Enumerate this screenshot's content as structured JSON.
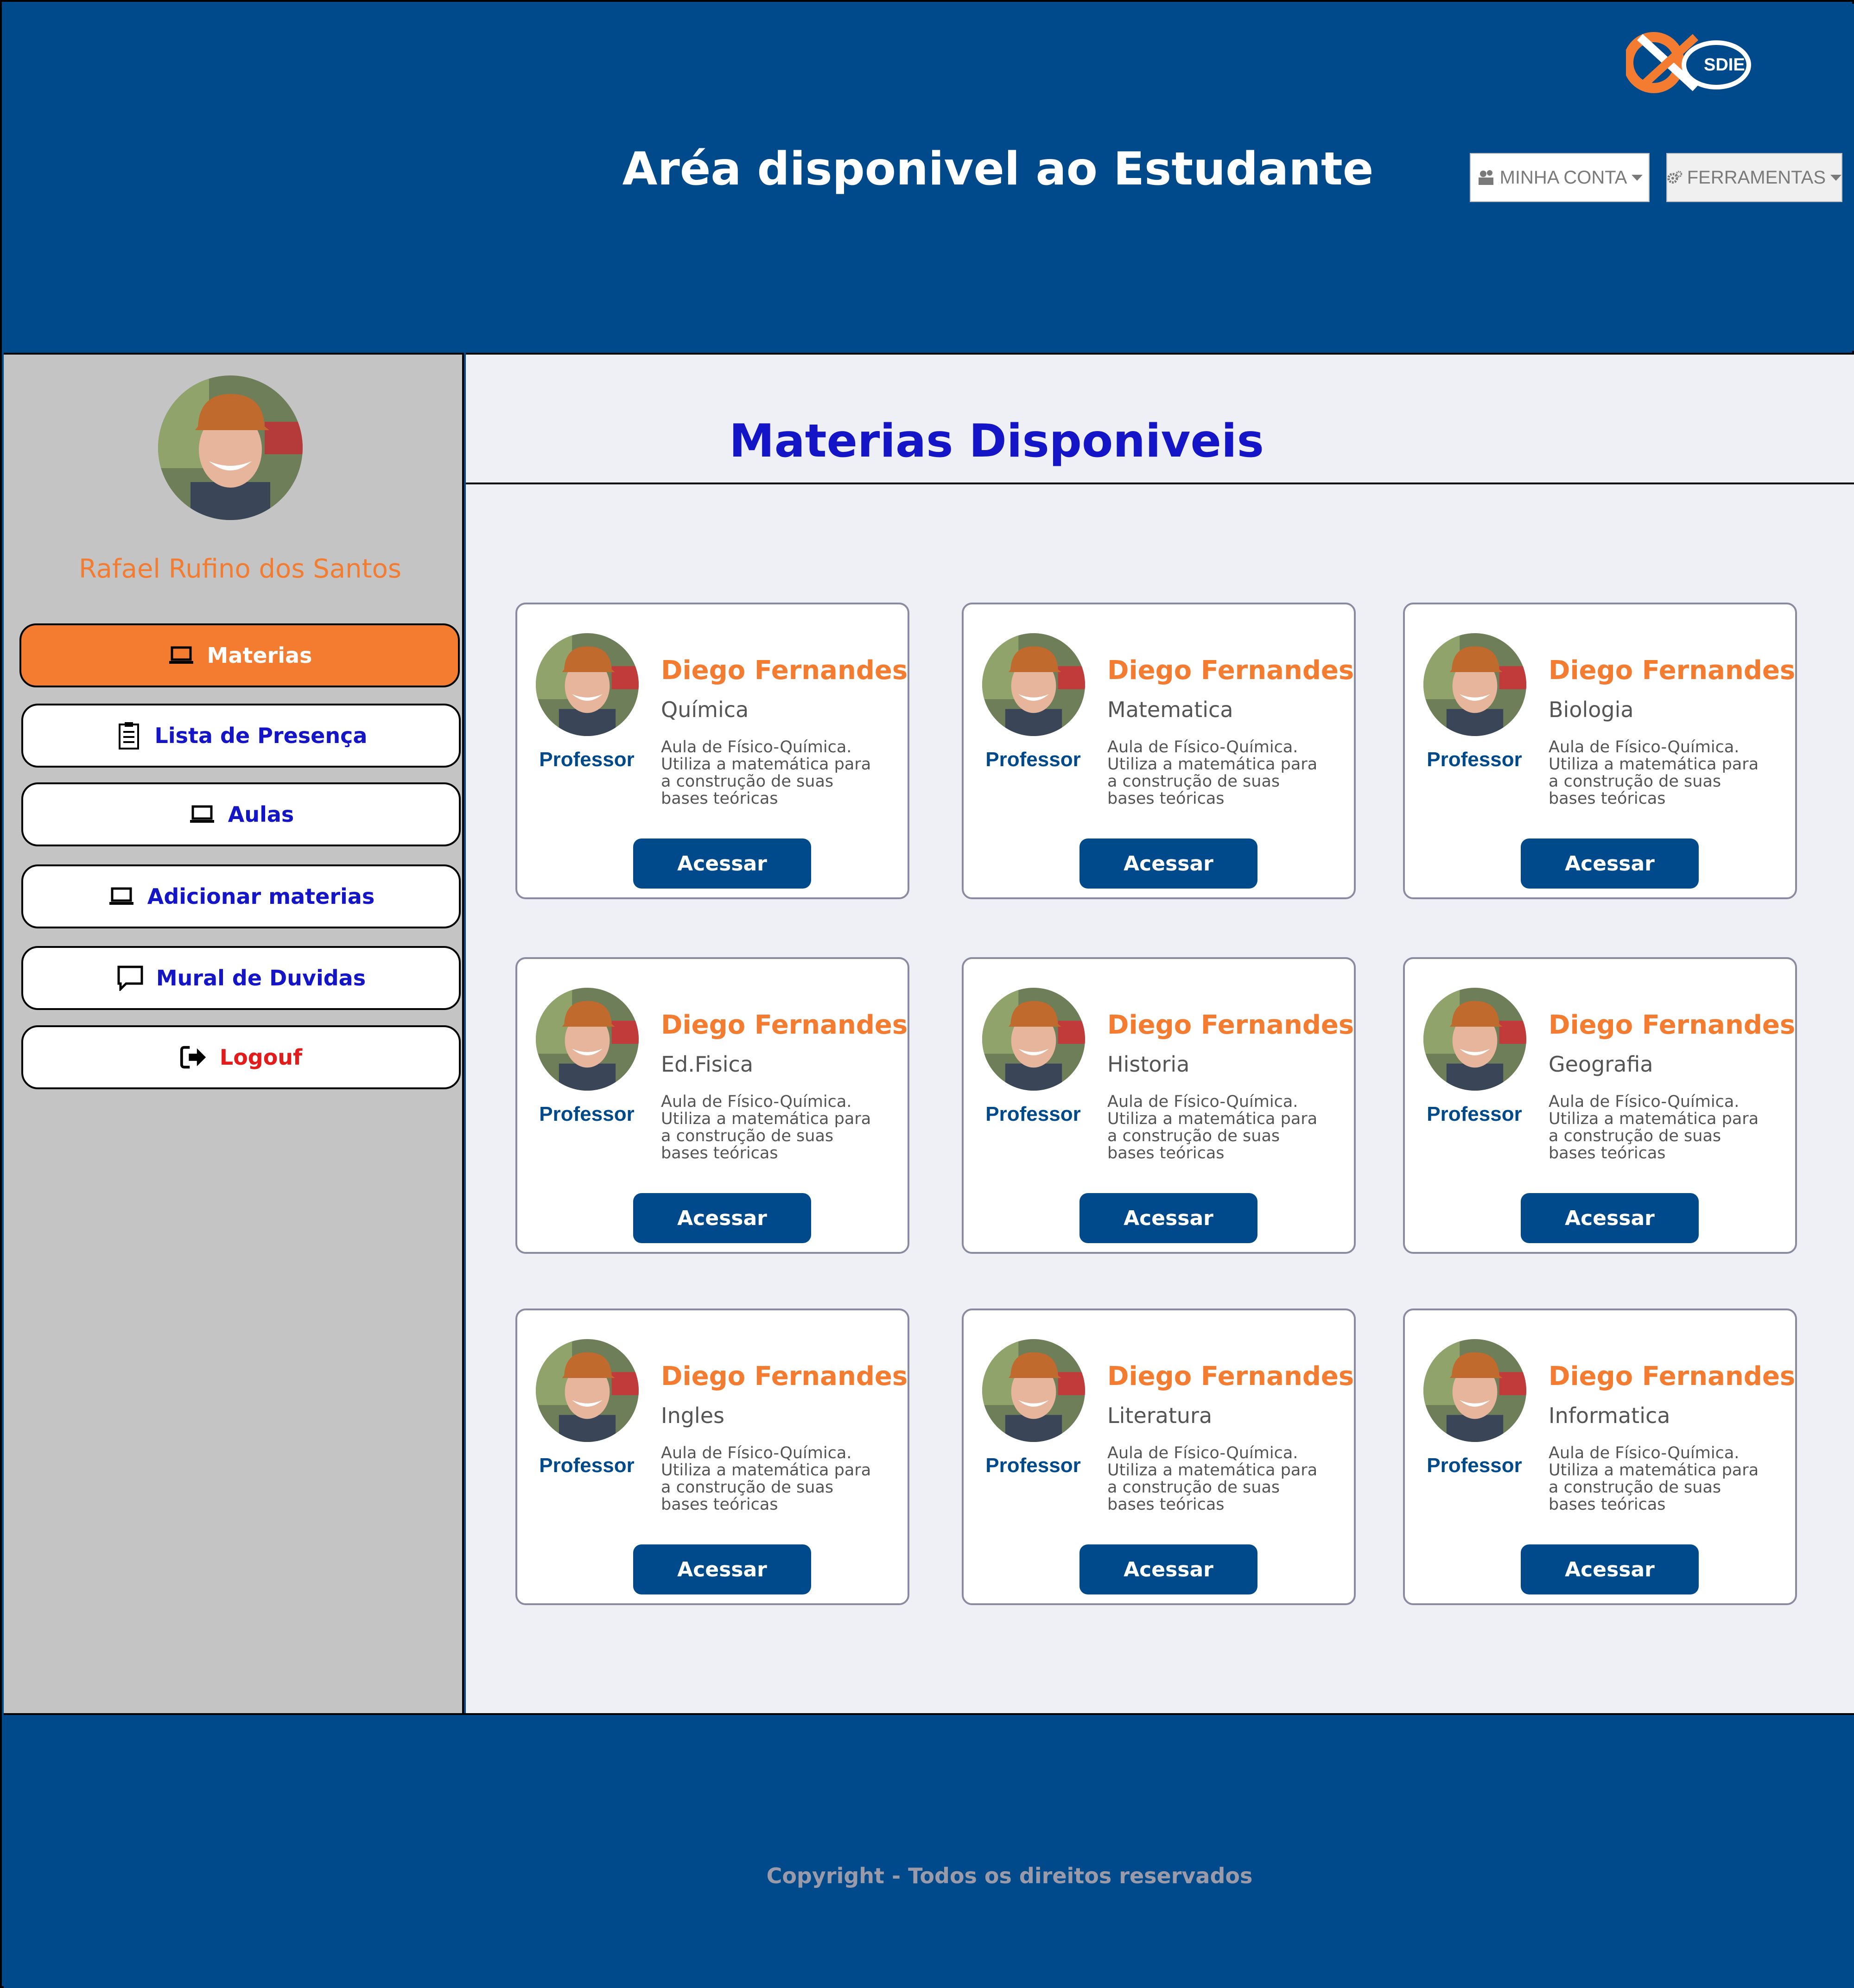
{
  "header": {
    "title": "Aréa disponivel ao Estudante",
    "logo_text": "SDIE",
    "account_label": "MINHA CONTA",
    "tools_label": "FERRAMENTAS",
    "account_icon": "user-icon",
    "tools_icon": "gear-icon"
  },
  "sidebar": {
    "student_name": "Rafael Rufino dos Santos",
    "items": [
      {
        "label": "Materias",
        "icon": "laptop-icon",
        "active": true
      },
      {
        "label": "Lista de Presença",
        "icon": "clipboard-icon"
      },
      {
        "label": "Aulas",
        "icon": "laptop-icon"
      },
      {
        "label": "Adicionar materias",
        "icon": "laptop-icon"
      },
      {
        "label": "Mural de Duvidas",
        "icon": "chat-icon"
      },
      {
        "label": "Logouf",
        "icon": "logout-icon"
      }
    ]
  },
  "main": {
    "title": "Materias Disponiveis",
    "cards": [
      {
        "teacher": "Diego Fernandes",
        "subject": "Química",
        "role": "Professor",
        "description": "Aula de Físico-Química. Utiliza a matemática para a construção de suas bases teóricas",
        "button": "Acessar"
      },
      {
        "teacher": "Diego Fernandes",
        "subject": "Matematica",
        "role": "Professor",
        "description": "Aula de Físico-Química. Utiliza a matemática para a construção de suas bases teóricas",
        "button": "Acessar"
      },
      {
        "teacher": "Diego Fernandes",
        "subject": "Biologia",
        "role": "Professor",
        "description": "Aula de Físico-Química. Utiliza a matemática para a construção de suas bases teóricas",
        "button": "Acessar"
      },
      {
        "teacher": "Diego Fernandes",
        "subject": "Ed.Fisica",
        "role": "Professor",
        "description": "Aula de Físico-Química. Utiliza a matemática para a construção de suas bases teóricas",
        "button": "Acessar"
      },
      {
        "teacher": "Diego Fernandes",
        "subject": "Historia",
        "role": "Professor",
        "description": "Aula de Físico-Química. Utiliza a matemática para a construção de suas bases teóricas",
        "button": "Acessar"
      },
      {
        "teacher": "Diego Fernandes",
        "subject": "Geografia",
        "role": "Professor",
        "description": "Aula de Físico-Química. Utiliza a matemática para a construção de suas bases teóricas",
        "button": "Acessar"
      },
      {
        "teacher": "Diego Fernandes",
        "subject": "Ingles",
        "role": "Professor",
        "description": "Aula de Físico-Química. Utiliza a matemática para a construção de suas bases teóricas",
        "button": "Acessar"
      },
      {
        "teacher": "Diego Fernandes",
        "subject": "Literatura",
        "role": "Professor",
        "description": "Aula de Físico-Química. Utiliza a matemática para a construção de suas bases teóricas",
        "button": "Acessar"
      },
      {
        "teacher": "Diego Fernandes",
        "subject": "Informatica",
        "role": "Professor",
        "description": "Aula de Físico-Química. Utiliza a matemática para a construção de suas bases teóricas",
        "button": "Acessar"
      }
    ]
  },
  "footer": {
    "copyright": "Copyright - Todos os direitos reservados"
  },
  "colors": {
    "brand_blue": "#004a8c",
    "accent_orange": "#f47c30",
    "nav_text": "#1515c8",
    "logout_red": "#e41b1b"
  }
}
